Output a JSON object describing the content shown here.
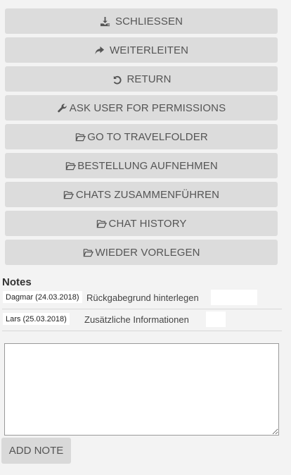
{
  "actions": [
    {
      "label": "SCHLIESSEN",
      "icon": "download-icon"
    },
    {
      "label": "WEITERLEITEN",
      "icon": "share-arrow-icon"
    },
    {
      "label": "RETURN",
      "icon": "undo-icon"
    },
    {
      "label": "ASK USER FOR PERMISSIONS",
      "icon": "wrench-icon"
    },
    {
      "label": "GO TO TRAVELFOLDER",
      "icon": "folder-open-icon"
    },
    {
      "label": "BESTELLUNG AUFNEHMEN",
      "icon": "folder-open-icon"
    },
    {
      "label": "CHATS ZUSAMMENFÜHREN",
      "icon": "folder-open-icon"
    },
    {
      "label": "CHAT HISTORY",
      "icon": "folder-open-icon"
    },
    {
      "label": "WIEDER VORLEGEN",
      "icon": "folder-open-icon"
    }
  ],
  "notes": {
    "heading": "Notes",
    "items": [
      {
        "author": "Dagmar (24.03.2018)",
        "text": "Rückgabegrund hinterlegen"
      },
      {
        "author": "Lars (25.03.2018)",
        "text": "Zusätzliche Informationen"
      }
    ],
    "textarea_value": "",
    "add_button": "ADD NOTE"
  },
  "colors": {
    "background": "#f3f3f3",
    "button": "#dcdcdc",
    "button_text": "#555555"
  }
}
